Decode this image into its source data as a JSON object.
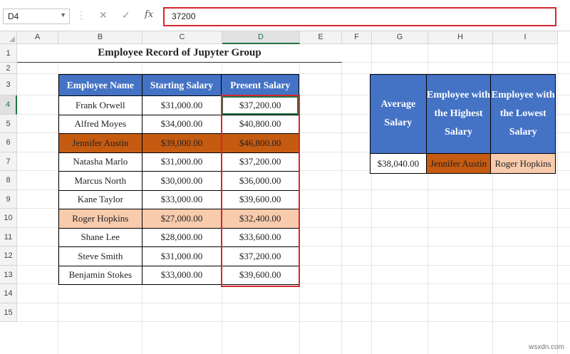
{
  "formula_bar": {
    "name_box": "D4",
    "formula": "37200",
    "cancel_icon": "✕",
    "enter_icon": "✓",
    "fx_label": "fx"
  },
  "columns": [
    "A",
    "B",
    "C",
    "D",
    "E",
    "F",
    "G",
    "H",
    "I"
  ],
  "rows": [
    "1",
    "2",
    "3",
    "4",
    "5",
    "6",
    "7",
    "8",
    "9",
    "10",
    "11",
    "12",
    "13",
    "14",
    "15"
  ],
  "selected_column": "D",
  "selected_row": "4",
  "sheet": {
    "title": "Employee Record of Jupyter Group",
    "headers": [
      "Employee Name",
      "Starting Salary",
      "Present Salary"
    ],
    "records": [
      {
        "name": "Frank Orwell",
        "start": "$31,000.00",
        "present": "$37,200.00"
      },
      {
        "name": "Alfred Moyes",
        "start": "$34,000.00",
        "present": "$40,800.00"
      },
      {
        "name": "Jennifer Austin",
        "start": "$39,000.00",
        "present": "$46,800.00"
      },
      {
        "name": "Natasha Marlo",
        "start": "$31,000.00",
        "present": "$37,200.00"
      },
      {
        "name": "Marcus North",
        "start": "$30,000.00",
        "present": "$36,000.00"
      },
      {
        "name": "Kane Taylor",
        "start": "$33,000.00",
        "present": "$39,600.00"
      },
      {
        "name": "Roger Hopkins",
        "start": "$27,000.00",
        "present": "$32,400.00"
      },
      {
        "name": "Shane Lee",
        "start": "$28,000.00",
        "present": "$33,600.00"
      },
      {
        "name": "Steve Smith",
        "start": "$31,000.00",
        "present": "$37,200.00"
      },
      {
        "name": "Benjamin Stokes",
        "start": "$33,000.00",
        "present": "$39,600.00"
      }
    ],
    "highest_row": "Jennifer Austin",
    "lowest_row": "Roger Hopkins"
  },
  "summary": {
    "headers": [
      "Average Salary",
      "Employee with the Highest Salary",
      "Employee with the Lowest Salary"
    ],
    "average": "$38,040.00",
    "highest": "Jennifer Austin",
    "lowest": "Roger Hopkins"
  },
  "colors": {
    "header_blue": "#4472c4",
    "highest_fill": "#c55a11",
    "lowest_fill": "#f8cbad",
    "highlight_red": "#d7262e",
    "excel_green": "#217346"
  },
  "watermark": "wsxdn.com"
}
